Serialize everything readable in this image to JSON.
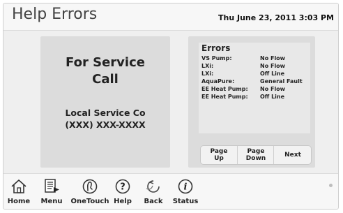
{
  "header": {
    "title": "Help Errors",
    "datetime": "Thu June 23, 2011  3:03 PM"
  },
  "service": {
    "heading_line1": "For Service",
    "heading_line2": "Call",
    "company": "Local Service Co",
    "phone": "(XXX) XXX-XXXX"
  },
  "errors": {
    "title": "Errors",
    "rows": [
      {
        "device": "VS Pump:",
        "status": "No Flow"
      },
      {
        "device": "LXi:",
        "status": "No Flow"
      },
      {
        "device": "LXi:",
        "status": "Off Line"
      },
      {
        "device": "AquaPure:",
        "status": "General Fault"
      },
      {
        "device": "EE Heat Pump:",
        "status": "No Flow"
      },
      {
        "device": "EE Heat Pump:",
        "status": "Off Line"
      }
    ],
    "buttons": {
      "page_up": "Page\nUp",
      "page_down": "Page\nDown",
      "next": "Next"
    }
  },
  "nav": {
    "items": [
      {
        "label": "Home",
        "icon": "home-icon"
      },
      {
        "label": "Menu",
        "icon": "menu-icon"
      },
      {
        "label": "OneTouch",
        "icon": "onetouch-icon"
      },
      {
        "label": "Help",
        "icon": "help-icon"
      },
      {
        "label": "Back",
        "icon": "back-icon"
      },
      {
        "label": "Status",
        "icon": "status-icon"
      }
    ]
  }
}
